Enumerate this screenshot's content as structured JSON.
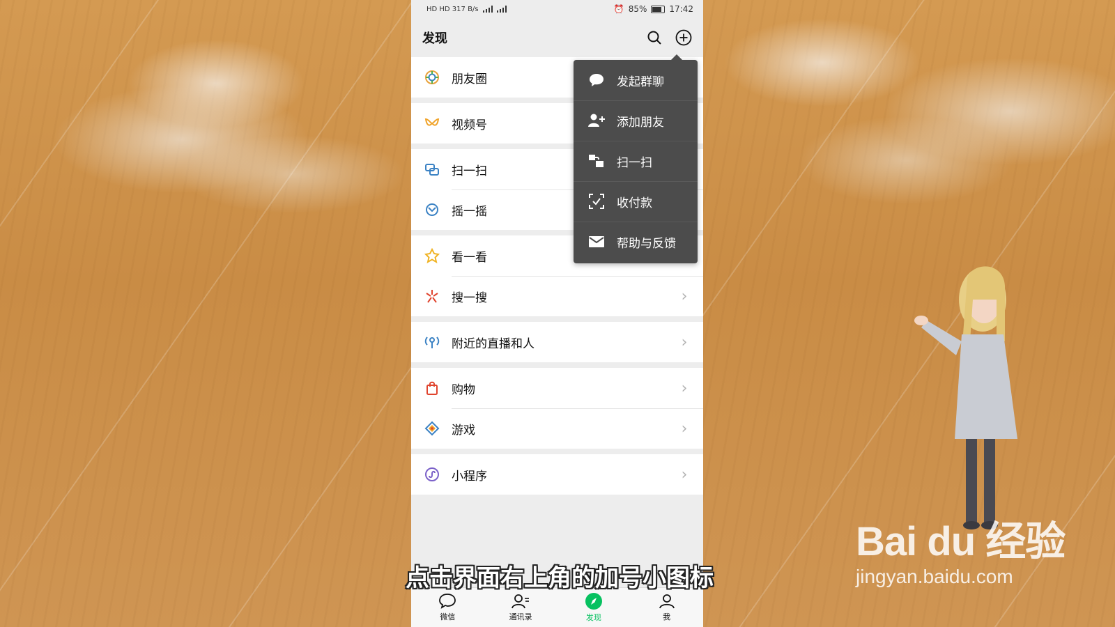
{
  "status_bar": {
    "left": "HD  HD  317 B/s",
    "battery": "85%",
    "time": "17:42"
  },
  "header": {
    "title": "发现"
  },
  "groups": [
    [
      {
        "label": "朋友圈",
        "icon": "moments-icon"
      }
    ],
    [
      {
        "label": "视频号",
        "icon": "channels-icon"
      }
    ],
    [
      {
        "label": "扫一扫",
        "icon": "scan-icon"
      },
      {
        "label": "摇一摇",
        "icon": "shake-icon"
      }
    ],
    [
      {
        "label": "看一看",
        "icon": "top-stories-icon"
      },
      {
        "label": "搜一搜",
        "icon": "search-icon"
      }
    ],
    [
      {
        "label": "附近的直播和人",
        "icon": "nearby-icon"
      }
    ],
    [
      {
        "label": "购物",
        "icon": "shopping-icon"
      },
      {
        "label": "游戏",
        "icon": "games-icon"
      }
    ],
    [
      {
        "label": "小程序",
        "icon": "mini-program-icon"
      }
    ]
  ],
  "popup_menu": [
    {
      "label": "发起群聊",
      "icon": "chat-bubble-icon"
    },
    {
      "label": "添加朋友",
      "icon": "add-friend-icon"
    },
    {
      "label": "扫一扫",
      "icon": "scan-icon"
    },
    {
      "label": "收付款",
      "icon": "payment-icon"
    },
    {
      "label": "帮助与反馈",
      "icon": "mail-icon"
    }
  ],
  "tabs": [
    {
      "label": "微信",
      "icon": "chat-icon"
    },
    {
      "label": "通讯录",
      "icon": "contacts-icon"
    },
    {
      "label": "发现",
      "icon": "discover-icon",
      "active": true
    },
    {
      "label": "我",
      "icon": "me-icon"
    }
  ],
  "caption": "点击界面右上角的加号小图标",
  "watermark": {
    "brand": "Bai du 经验",
    "url": "jingyan.baidu.com"
  },
  "colors": {
    "accent": "#07c160",
    "menu_bg": "#4c4c4c",
    "page_bg": "#ededed"
  }
}
